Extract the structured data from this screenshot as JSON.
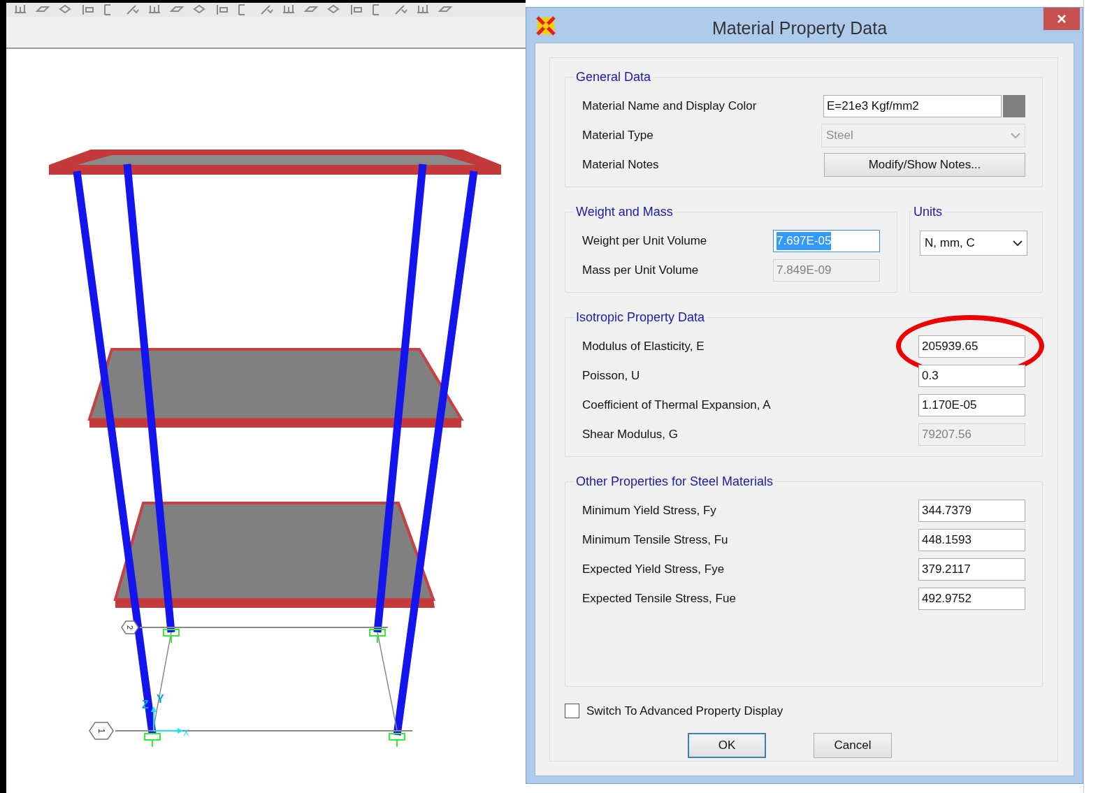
{
  "viewport": {
    "axis_labels": [
      "X",
      "Y",
      "Z"
    ],
    "grid_labels": [
      "2",
      "1"
    ]
  },
  "dialog": {
    "title": "Material Property Data",
    "general": {
      "title": "General Data",
      "rows": [
        {
          "kind": "name",
          "label": "Material Name and Display Color",
          "value": "E=21e3 Kgf/mm2",
          "color": "#808080"
        },
        {
          "kind": "select",
          "label": "Material Type",
          "value": "Steel",
          "disabled": true
        },
        {
          "kind": "button",
          "label": "Material Notes",
          "value": "Modify/Show Notes..."
        }
      ]
    },
    "weight": {
      "title": "Weight and Mass",
      "rows": [
        {
          "label": "Weight per Unit Volume",
          "value": "7.697E-05",
          "selected": true,
          "disabled": false
        },
        {
          "label": "Mass per Unit Volume",
          "value": "7.849E-09",
          "selected": false,
          "disabled": true
        }
      ]
    },
    "units": {
      "title": "Units",
      "value": "N, mm, C"
    },
    "isotropic": {
      "title": "Isotropic Property Data",
      "rows": [
        {
          "label": "Modulus of Elasticity,  E",
          "value": "205939.65",
          "disabled": false,
          "circled": true
        },
        {
          "label": "Poisson,  U",
          "value": "0.3",
          "disabled": false,
          "circled": false
        },
        {
          "label": "Coefficient of Thermal Expansion,  A",
          "value": "1.170E-05",
          "disabled": false,
          "circled": false
        },
        {
          "label": "Shear Modulus,  G",
          "value": "79207.56",
          "disabled": true,
          "circled": false
        }
      ]
    },
    "steel": {
      "title": "Other Properties for Steel Materials",
      "rows": [
        {
          "label": "Minimum Yield Stress, Fy",
          "value": "344.7379"
        },
        {
          "label": "Minimum Tensile Stress, Fu",
          "value": "448.1593"
        },
        {
          "label": "Expected Yield Stress, Fye",
          "value": "379.2117"
        },
        {
          "label": "Expected Tensile Stress, Fue",
          "value": "492.9752"
        }
      ]
    },
    "advanced": {
      "label": "Switch To Advanced Property Display",
      "checked": false
    },
    "buttons": [
      {
        "label": "OK",
        "default": true
      },
      {
        "label": "Cancel",
        "default": false
      }
    ]
  }
}
